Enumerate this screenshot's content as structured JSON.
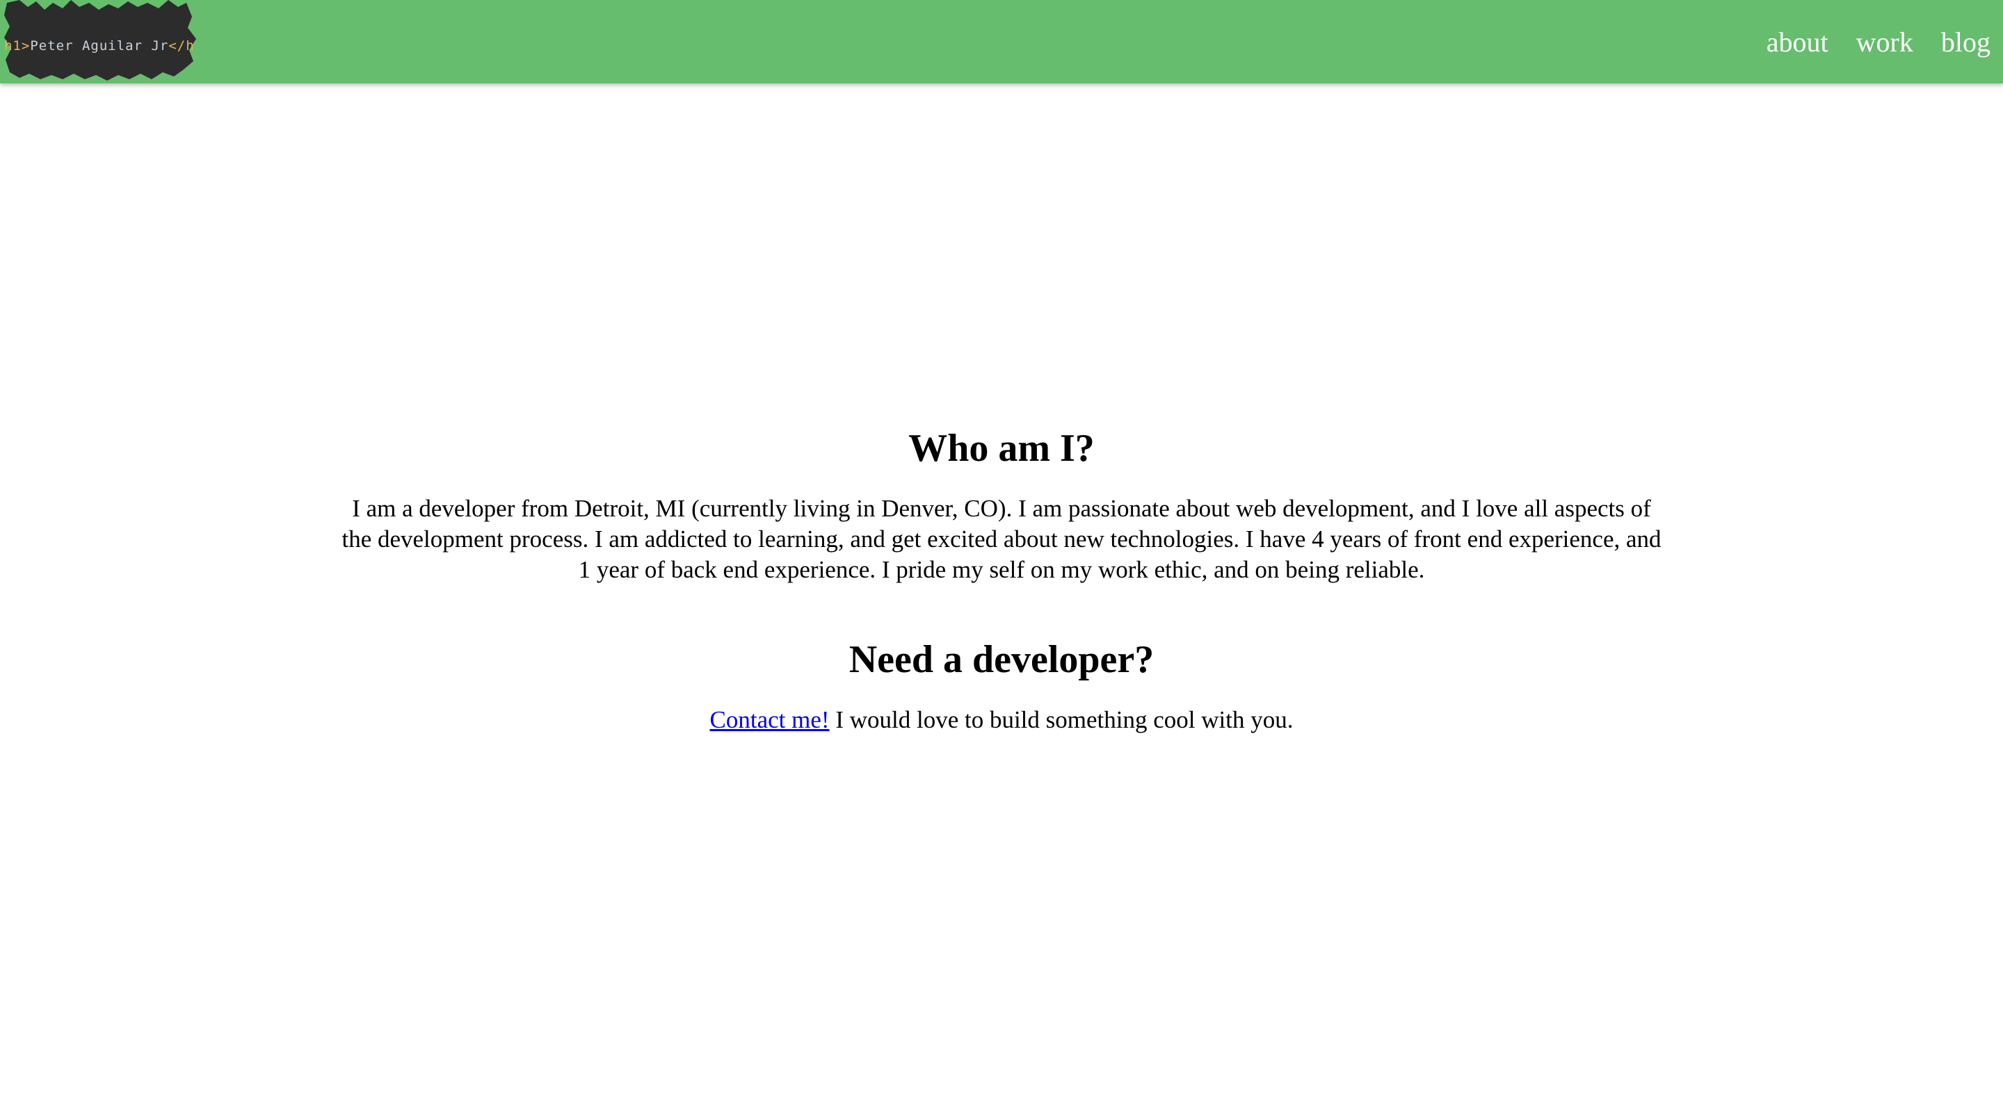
{
  "header": {
    "logo": {
      "open_tag": "h1>",
      "name": "Peter Aguilar Jr",
      "close_tag": "</h"
    },
    "nav": [
      {
        "label": "about"
      },
      {
        "label": "work"
      },
      {
        "label": "blog"
      }
    ],
    "colors": {
      "bar": "#66bd6d",
      "nav_text": "#ffffff",
      "logo_bg": "#2c2c2c"
    }
  },
  "main": {
    "about_heading": "Who am I?",
    "about_text": "I am a developer from Detroit, MI (currently living in Denver, CO). I am passionate about web development, and I love all aspects of the development process. I am addicted to learning, and get excited about new technologies. I have 4 years of front end experience, and 1 year of back end experience. I pride my self on my work ethic, and on being reliable.",
    "hire_heading": "Need a developer?",
    "contact_link": "Contact me!",
    "contact_text": " I would love to build something cool with you.",
    "colors": {
      "link": "#0000ee"
    }
  }
}
